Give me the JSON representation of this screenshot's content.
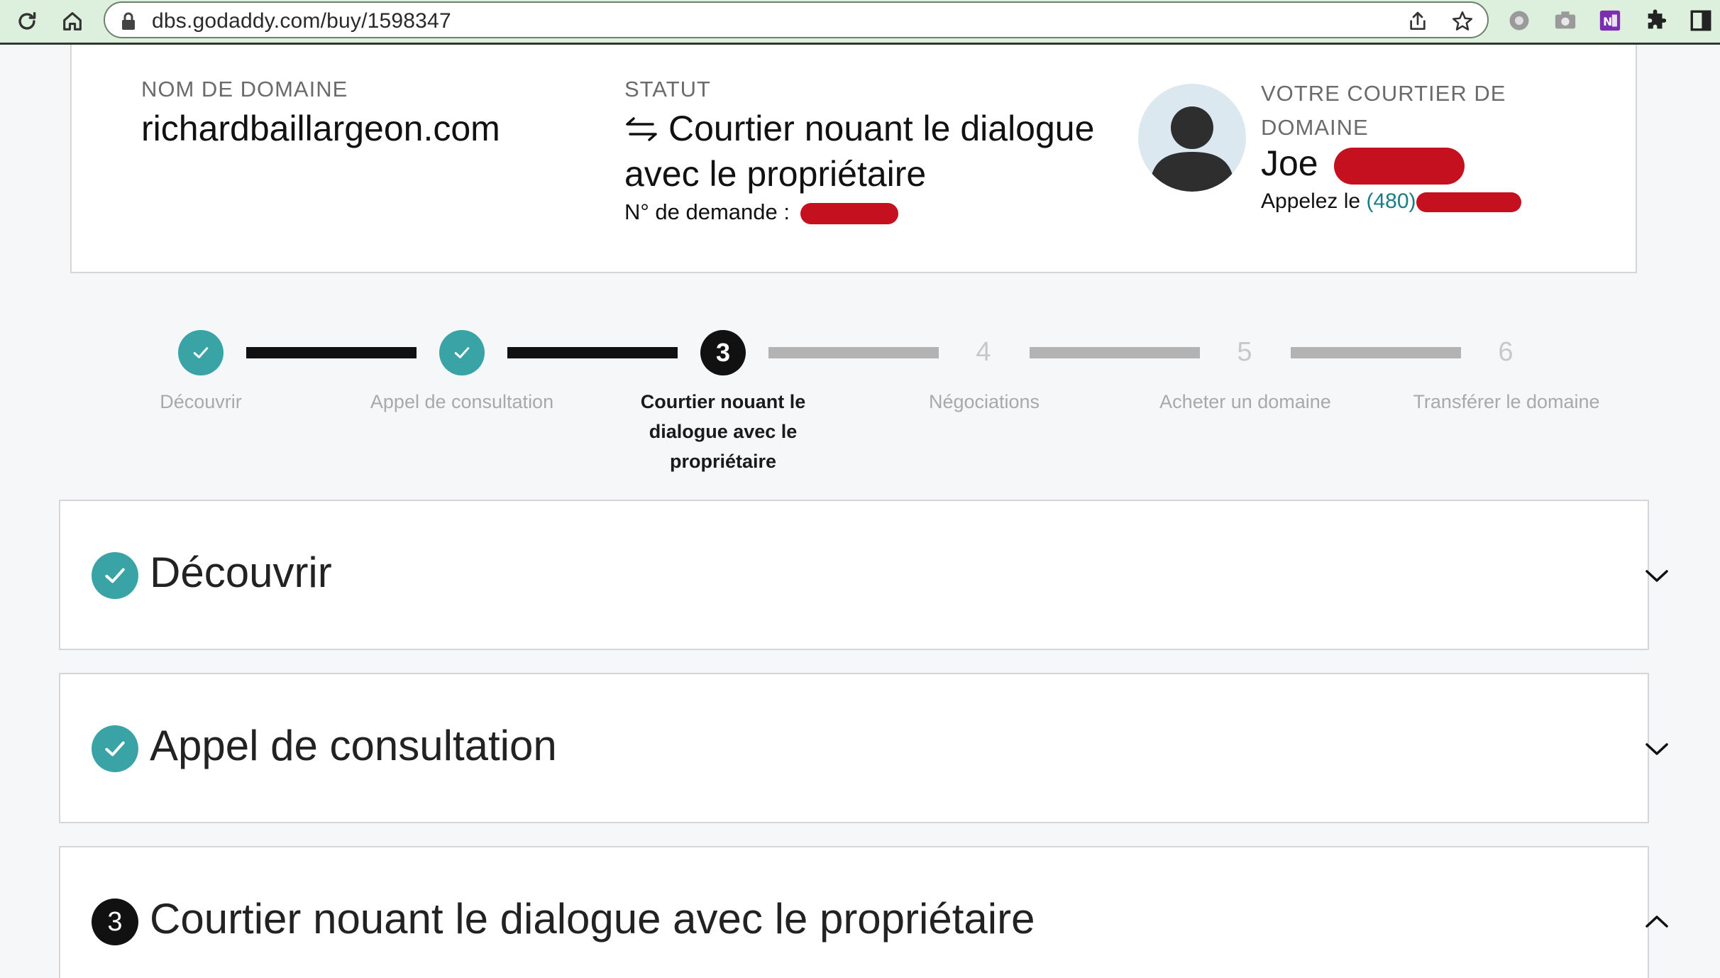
{
  "browser": {
    "url": "dbs.godaddy.com/buy/1598347"
  },
  "info": {
    "domain_label": "NOM DE DOMAINE",
    "domain_value": "richardbaillargeon.com",
    "status_label": "STATUT",
    "status_value": "Courtier nouant le dialogue avec le propriétaire",
    "request_label": "N° de demande :",
    "broker_label": "VOTRE COURTIER DE DOMAINE",
    "broker_name": "Joe",
    "call_label": "Appelez le",
    "phone_prefix": "(480)"
  },
  "stepper": {
    "steps": [
      {
        "number": "1",
        "label": "Découvrir",
        "state": "done"
      },
      {
        "number": "2",
        "label": "Appel de consultation",
        "state": "done"
      },
      {
        "number": "3",
        "label": "Courtier nouant le dialogue avec le propriétaire",
        "state": "current"
      },
      {
        "number": "4",
        "label": "Négociations",
        "state": "todo"
      },
      {
        "number": "5",
        "label": "Acheter un domaine",
        "state": "todo"
      },
      {
        "number": "6",
        "label": "Transférer le domaine",
        "state": "todo"
      }
    ]
  },
  "accordions": [
    {
      "title": "Découvrir",
      "state": "done",
      "expanded": false
    },
    {
      "title": "Appel de consultation",
      "state": "done",
      "expanded": false
    },
    {
      "title": "Courtier nouant le dialogue avec le propriétaire",
      "badge": "3",
      "state": "current",
      "expanded": true
    }
  ],
  "colors": {
    "accent_teal": "#3aa3a6",
    "phone_link": "#1a7d84",
    "redaction": "#c4101f"
  }
}
